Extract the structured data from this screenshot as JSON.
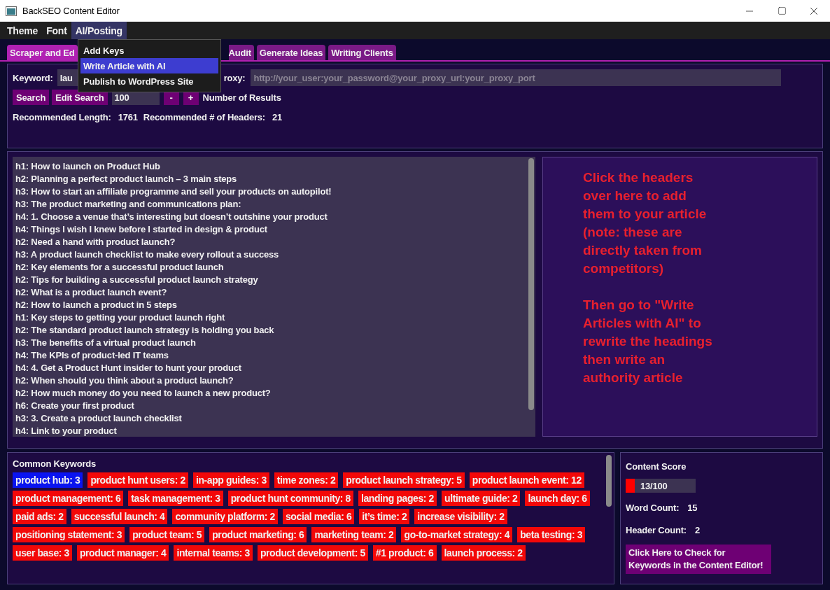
{
  "window": {
    "title": "BackSEO Content Editor"
  },
  "menu_bar": [
    {
      "label": "Theme",
      "selected": false
    },
    {
      "label": "Font",
      "selected": false
    },
    {
      "label": "AI/Posting",
      "selected": true
    }
  ],
  "open_menu": [
    {
      "label": "Add Keys",
      "selected": false
    },
    {
      "label": "Write Article with AI",
      "selected": true
    },
    {
      "label": "Publish to WordPress Site",
      "selected": false
    }
  ],
  "tabs": [
    {
      "label": "Scraper and Ed",
      "selected": true
    },
    {
      "label": "Audit",
      "selected": false
    },
    {
      "label": "Generate Ideas",
      "selected": false
    },
    {
      "label": "Writing Clients",
      "selected": false
    }
  ],
  "search": {
    "keyword_label": "Keyword:",
    "keyword_value": "lau",
    "proxy_label": "roxy:",
    "proxy_placeholder": "http://your_user:your_password@your_proxy_url:your_proxy_port",
    "search_button": "Search",
    "edit_button": "Edit Search",
    "results_value": "100",
    "minus": "-",
    "plus": "+",
    "results_label": "Number of Results",
    "length_label": "Recommended Length:",
    "length_value": "1761",
    "headers_label": "Recommended # of Headers:",
    "headers_value": "21"
  },
  "headers": [
    "h1: How to launch on Product Hub",
    "h2: Planning a perfect product launch – 3 main steps",
    "h3: How to start an affiliate programme and sell your products on autopilot!",
    "h3: The product marketing and communications plan:",
    "h4: 1. Choose a venue that’s interesting but doesn’t outshine your product",
    "h4: Things I wish I knew before I started in design & product",
    "h2: Need a hand with product launch?",
    "h3: A product launch checklist to make every rollout a success",
    "h2: Key elements for a successful product launch",
    "h2: Tips for building a successful product launch strategy",
    "h2: What is a product launch event?",
    "h2: How to launch a product in 5 steps",
    "h1: Key steps to getting your product launch right",
    "h2: The standard product launch strategy is holding you back",
    "h3: The benefits of a virtual product launch",
    "h4: The KPIs of product-led IT teams",
    "h4: 4. Get a Product Hunt insider to hunt your product",
    "h2: When should you think about a product launch?",
    "h2: How much money do you need to launch a new product?",
    "h6: Create your first product",
    "h3: 3. Create a product launch checklist",
    "h4: Link to your product"
  ],
  "hint": [
    "Click the headers over here to add them to your article (note: these are directly taken from competitors)",
    "Then go to \"Write Articles with AI\" to rewrite the headings then write an authority article"
  ],
  "keywords": {
    "title": "Common Keywords",
    "items": [
      {
        "label": "product hub: 3",
        "selected": true
      },
      {
        "label": "product hunt users: 2",
        "selected": false
      },
      {
        "label": "in-app guides: 3",
        "selected": false
      },
      {
        "label": "time zones: 2",
        "selected": false
      },
      {
        "label": "product launch strategy: 5",
        "selected": false
      },
      {
        "label": "product launch event: 12",
        "selected": false
      },
      {
        "label": "product management: 6",
        "selected": false
      },
      {
        "label": "task management: 3",
        "selected": false
      },
      {
        "label": "product hunt community: 8",
        "selected": false
      },
      {
        "label": "landing pages: 2",
        "selected": false
      },
      {
        "label": "ultimate guide: 2",
        "selected": false
      },
      {
        "label": "launch day: 6",
        "selected": false
      },
      {
        "label": "paid ads: 2",
        "selected": false
      },
      {
        "label": "successful launch: 4",
        "selected": false
      },
      {
        "label": "community platform: 2",
        "selected": false
      },
      {
        "label": "social media: 6",
        "selected": false
      },
      {
        "label": "it’s time: 2",
        "selected": false
      },
      {
        "label": "increase visibility: 2",
        "selected": false
      },
      {
        "label": "positioning statement: 3",
        "selected": false
      },
      {
        "label": "product team: 5",
        "selected": false
      },
      {
        "label": "product marketing: 6",
        "selected": false
      },
      {
        "label": "marketing team: 2",
        "selected": false
      },
      {
        "label": "go-to-market strategy: 4",
        "selected": false
      },
      {
        "label": "beta testing: 3",
        "selected": false
      },
      {
        "label": "user base: 3",
        "selected": false
      },
      {
        "label": "product manager: 4",
        "selected": false
      },
      {
        "label": "internal teams: 3",
        "selected": false
      },
      {
        "label": "product development: 5",
        "selected": false
      },
      {
        "label": "#1 product: 6",
        "selected": false
      },
      {
        "label": "launch process: 2",
        "selected": false
      }
    ]
  },
  "score": {
    "title": "Content Score",
    "level": 0.13,
    "reading": "13/100",
    "word_count_label": "Word Count:",
    "word_count_value": "15",
    "header_count_label": "Header Count:",
    "header_count_value": "2",
    "check_button": "Click Here to Check for Keywords in the Content Editor!"
  }
}
